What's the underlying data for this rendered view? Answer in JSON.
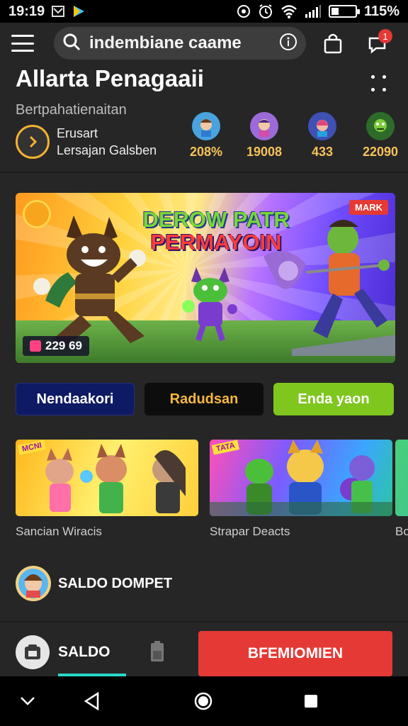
{
  "status_bar": {
    "time": "19:19",
    "battery_percent": "115%",
    "icons": [
      "mail-icon",
      "play-icon",
      "sync-icon",
      "alarm-icon",
      "wifi-icon",
      "signal-icon",
      "battery-icon"
    ]
  },
  "top_bar": {
    "search_value": "indembiane caame",
    "notification_count": "1"
  },
  "header": {
    "title": "Allarta Penagaaii",
    "subtitle": "Bertpahatienaitan",
    "promo_line1": "Erusart",
    "promo_line2": "Lersajan Galsben"
  },
  "stats": [
    {
      "value": "208%",
      "color": "#4aa3df"
    },
    {
      "value": "19008",
      "color": "#9c6ad9"
    },
    {
      "value": "433",
      "color": "#3f51b5"
    },
    {
      "value": "22090",
      "color": "#4caf50"
    }
  ],
  "banner": {
    "title_line1": "DEROW PATR",
    "title_line2": "PERMAYOIN",
    "badge": "MARK",
    "count": "229 69"
  },
  "actions": {
    "button1": "Nendaakori",
    "button2": "Radudsan",
    "button3": "Enda yaon"
  },
  "cards": [
    {
      "label": "Sancian Wiracis",
      "tag": "MCNI"
    },
    {
      "label": "Strapar Deacts",
      "tag": "TATA"
    },
    {
      "label": "Bo",
      "tag": ""
    }
  ],
  "wallet": {
    "label": "SALDO DOMPET"
  },
  "bottom_bar": {
    "saldo_label": "SALDO",
    "primary_button": "BFEMIOMIEN"
  },
  "colors": {
    "accent_gold": "#f6c35a",
    "primary_red": "#e53935",
    "green": "#7fc61f",
    "navy": "#0e1a63",
    "teal": "#2ad6c8"
  }
}
